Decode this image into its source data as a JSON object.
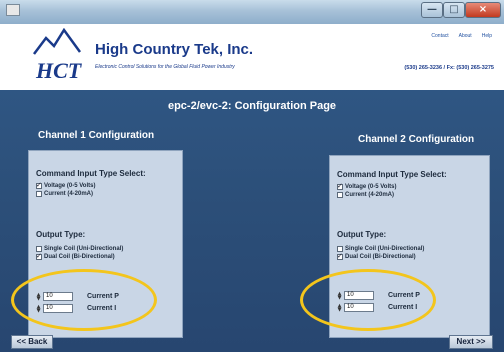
{
  "window": {
    "close_label": "×",
    "min_label": "—",
    "max_label": "□"
  },
  "header": {
    "brand": "High Country Tek, Inc.",
    "tagline": "Electronic Control Solutions for the Global Fluid Power Industry",
    "links": [
      "Contact",
      "About",
      "Help"
    ],
    "phone": "(530) 265-3236 / Fx: (530) 265-3275",
    "logo_text": "HCT"
  },
  "page": {
    "title": "epc-2/evc-2: Configuration Page"
  },
  "channels": [
    {
      "title": "Channel 1 Configuration",
      "command_heading": "Command Input Type Select:",
      "command_options": [
        {
          "label": "Voltage (0-5 Volts)",
          "checked": true
        },
        {
          "label": "Current (4-20mA)",
          "checked": false
        }
      ],
      "output_heading": "Output Type:",
      "output_options": [
        {
          "label": "Single Coil (Uni-Directional)",
          "checked": false
        },
        {
          "label": "Dual Coil (Bi-Directional)",
          "checked": true
        }
      ],
      "params": [
        {
          "value": "10",
          "label": "Current P"
        },
        {
          "value": "10",
          "label": "Current I"
        }
      ]
    },
    {
      "title": "Channel 2 Configuration",
      "command_heading": "Command Input Type Select:",
      "command_options": [
        {
          "label": "Voltage (0-5 Volts)",
          "checked": true
        },
        {
          "label": "Current (4-20mA)",
          "checked": false
        }
      ],
      "output_heading": "Output Type:",
      "output_options": [
        {
          "label": "Single Coil (Uni-Directional)",
          "checked": false
        },
        {
          "label": "Dual Coil (Bi-Directional)",
          "checked": true
        }
      ],
      "params": [
        {
          "value": "10",
          "label": "Current P"
        },
        {
          "value": "10",
          "label": "Current I"
        }
      ]
    }
  ],
  "nav": {
    "back_label": "<< Back",
    "next_label": "Next >>"
  },
  "colors": {
    "highlight": "#f3c51c",
    "page_bg": "#2c4f79",
    "panel_bg": "#c9d6e6",
    "brand": "#1a3a8a"
  }
}
